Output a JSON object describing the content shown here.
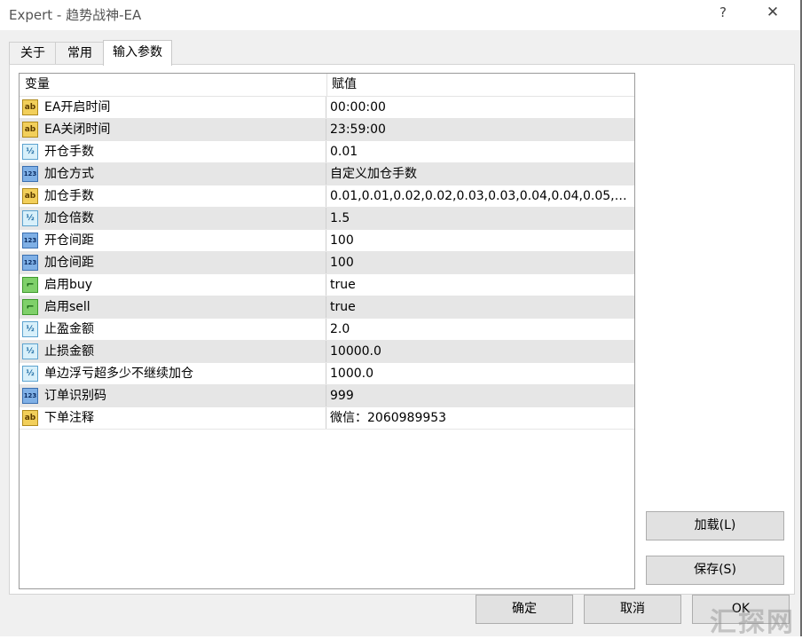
{
  "window": {
    "title": "Expert - 趋势战神-EA",
    "help_label": "?",
    "close_label": "✕"
  },
  "tabs": [
    {
      "label": "关于"
    },
    {
      "label": "常用"
    },
    {
      "label": "输入参数"
    }
  ],
  "table": {
    "headers": {
      "variable": "变量",
      "value": "赋值"
    },
    "rows": [
      {
        "icon": "ab-string-icon",
        "name": "EA开启时间",
        "value": "00:00:00"
      },
      {
        "icon": "ab-string-icon",
        "name": "EA关闭时间",
        "value": "23:59:00"
      },
      {
        "icon": "half-double-icon",
        "name": "开仓手数",
        "value": "0.01"
      },
      {
        "icon": "123-integer-icon",
        "name": "加仓方式",
        "value": "自定义加仓手数"
      },
      {
        "icon": "ab-string-icon",
        "name": "加仓手数",
        "value": "0.01,0.01,0.02,0.02,0.03,0.03,0.04,0.04,0.05,0..."
      },
      {
        "icon": "half-double-icon",
        "name": "加仓倍数",
        "value": "1.5"
      },
      {
        "icon": "123-integer-icon",
        "name": "开仓间距",
        "value": "100"
      },
      {
        "icon": "123-integer-icon",
        "name": "加仓间距",
        "value": "100"
      },
      {
        "icon": "bool-toggle-icon",
        "name": "启用buy",
        "value": "true"
      },
      {
        "icon": "bool-toggle-icon",
        "name": "启用sell",
        "value": "true"
      },
      {
        "icon": "half-double-icon",
        "name": "止盈金额",
        "value": "2.0"
      },
      {
        "icon": "half-double-icon",
        "name": "止损金额",
        "value": "10000.0"
      },
      {
        "icon": "half-double-icon",
        "name": "单边浮亏超多少不继续加仓",
        "value": "1000.0"
      },
      {
        "icon": "123-integer-icon",
        "name": "订单识别码",
        "value": "999"
      },
      {
        "icon": "ab-string-icon",
        "name": "下单注释",
        "value": "微信：2060989953"
      }
    ]
  },
  "side_buttons": {
    "load": "加载(L)",
    "save": "保存(S)"
  },
  "footer_buttons": {
    "ok": "确定",
    "cancel": "取消",
    "reset": "OK"
  },
  "watermark": "汇探网"
}
